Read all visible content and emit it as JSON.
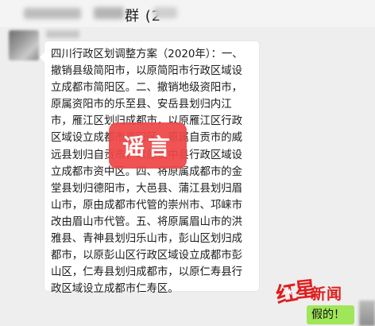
{
  "chat": {
    "title_suffix": "群 (2",
    "message_text": "四川行政区划调整方案（2020年）：一、撤销县级简阳市，以原简阳市行政区域设立成都市简阳区。二、撤销地级资阳市，原属资阳市的乐至县、安岳县划归内江市，雁江区划归成都市，以原雁江区行政区域设立成都市资阳区。原属自贡市的威远县划归自贡市，以原资中县行政区域设立成都市资中区。四、将原属成都市的金堂县划归德阳市，大邑县、蒲江县划归眉山市，原由成都市代管的崇州市、邛崃市改由眉山市代管。五、将原属眉山市的洪雅县、青神县划归乐山市，彭山区划归成都市，以原彭山区行政区域设立成都市彭山区，仁寿县划归成都市，以原仁寿县行政区域设立成都市仁寿区。",
    "stamp_label": "谣言",
    "reply_text": "假的！"
  },
  "watermark": {
    "hong": "红",
    "xing": "星",
    "news": "新闻",
    "color": "#e01e1e"
  },
  "colors": {
    "stamp": "#ee4747",
    "reply_bubble": "#9fe658",
    "background": "#eeeeee"
  }
}
